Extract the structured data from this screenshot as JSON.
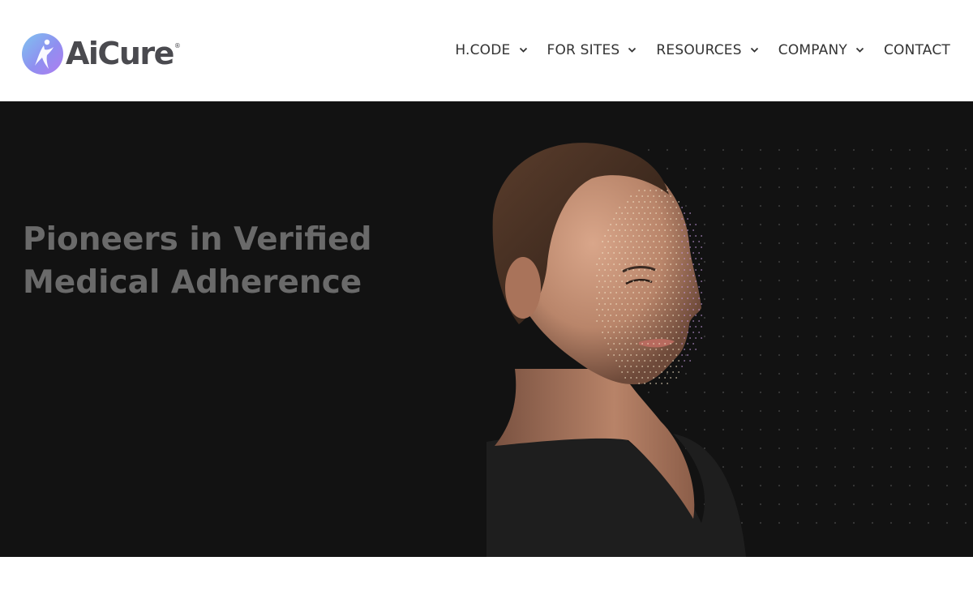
{
  "brand": {
    "name": "AiCure",
    "registered_mark": "®",
    "logo_icon": "dancer-figure-icon",
    "colors": {
      "gradient_start": "#7fc3ef",
      "gradient_mid": "#8f8ff0",
      "gradient_end": "#b07cf0",
      "wordmark": "#4a4a4f"
    }
  },
  "nav": {
    "items": [
      {
        "label": "H.CODE",
        "has_dropdown": true
      },
      {
        "label": "FOR SITES",
        "has_dropdown": true
      },
      {
        "label": "RESOURCES",
        "has_dropdown": true
      },
      {
        "label": "COMPANY",
        "has_dropdown": true
      },
      {
        "label": "CONTACT",
        "has_dropdown": false
      }
    ],
    "chevron_icon": "chevron-down-icon"
  },
  "hero": {
    "title_line1": "Pioneers in Verified",
    "title_line2": "Medical Adherence",
    "background_color": "#121212",
    "title_color": "#6a6a6a",
    "image_description_icon": "face-scan-image"
  }
}
